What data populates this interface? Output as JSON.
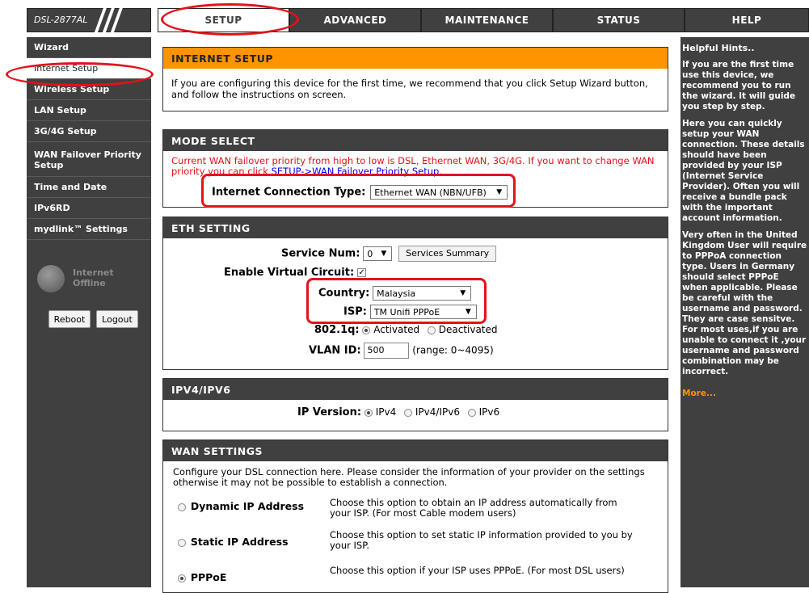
{
  "header": {
    "model": "DSL-2877AL",
    "tabs": [
      "SETUP",
      "ADVANCED",
      "MAINTENANCE",
      "STATUS",
      "HELP"
    ]
  },
  "sidebar": {
    "items": [
      "Wizard",
      "Internet Setup",
      "Wireless Setup",
      "LAN Setup",
      "3G/4G Setup",
      "WAN Failover Priority Setup",
      "Time and Date",
      "IPv6RD",
      "mydlink™ Settings"
    ],
    "status_line1": "Internet",
    "status_line2": "Offline",
    "reboot": "Reboot",
    "logout": "Logout"
  },
  "internet_setup": {
    "title": "INTERNET SETUP",
    "desc": "If you are configuring this device for the first time, we recommend that you click Setup Wizard button, and follow the instructions on screen."
  },
  "mode_select": {
    "title": "MODE SELECT",
    "warning_1": "Current WAN failover priority from high to low is DSL, Ethernet WAN, 3G/4G. If you want to change WAN",
    "warning_2": "priority you can click",
    "warning_link": "SETUP->WAN Failover Priority Setup",
    "warning_end": ".",
    "conn_label": "Internet Connection Type:",
    "conn_value": "Ethernet WAN (NBN/UFB)"
  },
  "eth_setting": {
    "title": "ETH SETTING",
    "service_num_label": "Service Num:",
    "service_num_value": "0",
    "services_summary": "Services Summary",
    "evc_label": "Enable Virtual Circuit:",
    "country_label": "Country:",
    "country_value": "Malaysia",
    "isp_label": "ISP:",
    "isp_value": "TM Unifi PPPoE",
    "q_label": "802.1q:",
    "q_activated": "Activated",
    "q_deactivated": "Deactivated",
    "vlan_label": "VLAN ID:",
    "vlan_value": "500",
    "vlan_range": "(range: 0~4095)"
  },
  "ip_section": {
    "title": "IPV4/IPV6",
    "label": "IP Version:",
    "opt1": "IPv4",
    "opt2": "IPv4/IPv6",
    "opt3": "IPv6"
  },
  "wan_settings": {
    "title": "WAN SETTINGS",
    "intro": "Configure your DSL connection here. Please consider the information of your provider on the settings otherwise it may not be possible to establish a connection.",
    "options": [
      {
        "label": "Dynamic IP Address",
        "desc": "Choose this option to obtain an IP address automatically from your ISP. (For most Cable modem users)"
      },
      {
        "label": "Static IP Address",
        "desc": "Choose this option to set static IP information provided to you by your ISP."
      },
      {
        "label": "PPPoE",
        "desc": "Choose this option if your ISP uses PPPoE. (For most DSL users)"
      }
    ]
  },
  "hints": {
    "title": "Helpful Hints..",
    "p1": "If you are the first time use this device, we recommend you to run the wizard. It will guide you step by step.",
    "p2": "Here you can quickly setup your WAN connection. These details should have been provided by your ISP (Internet Service Provider). Often you will receive a bundle pack with the important account information.",
    "p3": "Very often in the United Kingdom User will require to PPPoA connection type. Users in Germany should select PPPoE when applicable. Please be careful with the username and password. They are case sensitve. For most uses,if you are unable to connect it ,your username and password combination may be incorrect.",
    "more": "More..."
  },
  "colors": {
    "accent_orange": "#ff9300",
    "annotation_red": "#e3121a",
    "bar_gray": "#404040"
  }
}
